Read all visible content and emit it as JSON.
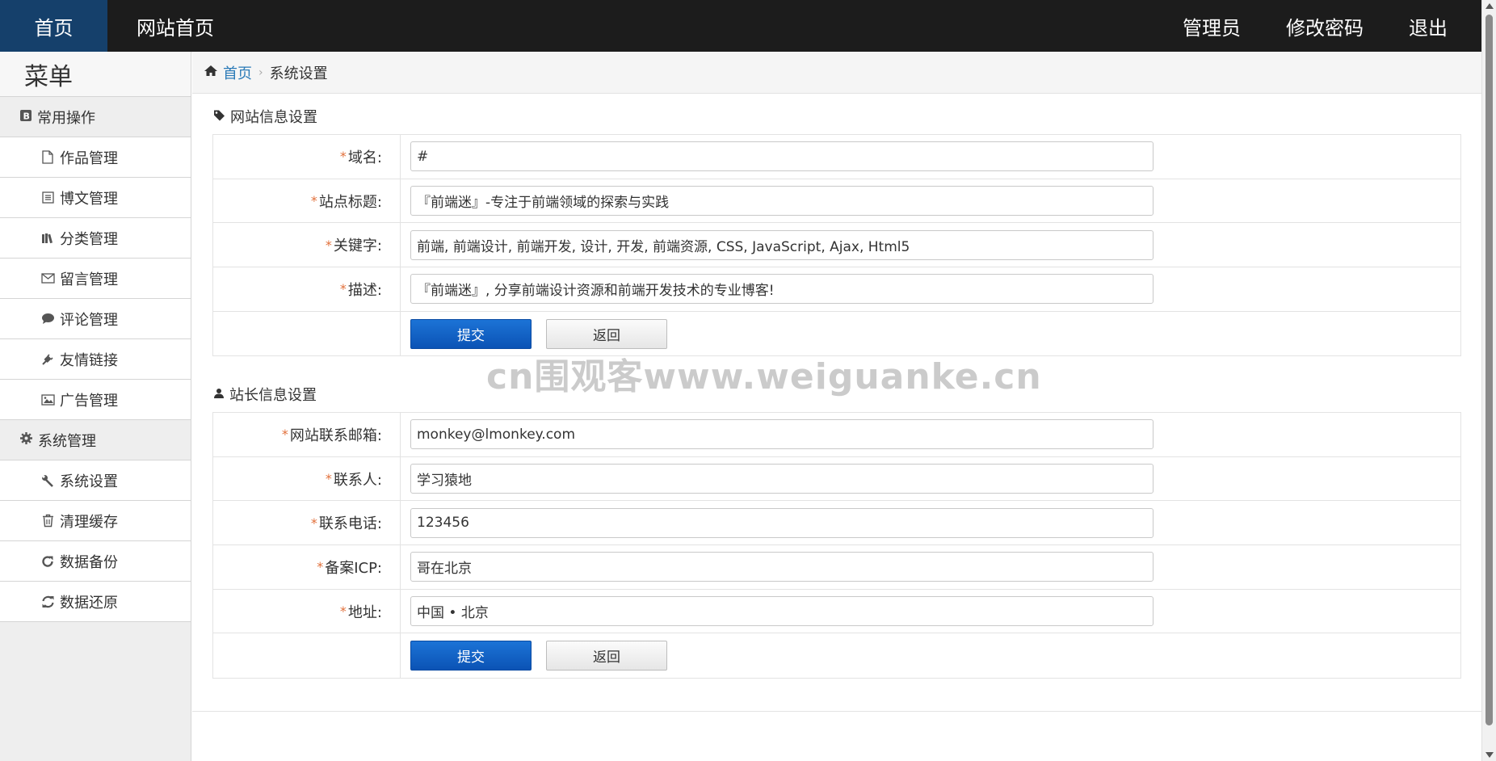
{
  "topbar": {
    "home": "首页",
    "site_home": "网站首页",
    "admin": "管理员",
    "change_password": "修改密码",
    "logout": "退出"
  },
  "sidebar": {
    "title": "菜单",
    "groups": [
      {
        "label": "常用操作",
        "icon": "b-square-icon",
        "items": [
          {
            "label": "作品管理",
            "icon": "file-icon"
          },
          {
            "label": "博文管理",
            "icon": "list-alt-icon"
          },
          {
            "label": "分类管理",
            "icon": "books-icon"
          },
          {
            "label": "留言管理",
            "icon": "envelope-icon"
          },
          {
            "label": "评论管理",
            "icon": "comment-icon"
          },
          {
            "label": "友情链接",
            "icon": "plug-icon"
          },
          {
            "label": "广告管理",
            "icon": "picture-icon"
          }
        ]
      },
      {
        "label": "系统管理",
        "icon": "gear-icon",
        "items": [
          {
            "label": "系统设置",
            "icon": "wrench-icon"
          },
          {
            "label": "清理缓存",
            "icon": "trash-icon"
          },
          {
            "label": "数据备份",
            "icon": "refresh-icon"
          },
          {
            "label": "数据还原",
            "icon": "sync-icon"
          }
        ]
      }
    ]
  },
  "breadcrumb": {
    "home": "首页",
    "current": "系统设置"
  },
  "site_section": {
    "title": "网站信息设置",
    "fields": [
      {
        "label": "域名:",
        "value": "#"
      },
      {
        "label": "站点标题:",
        "value": "『前端迷』-专注于前端领域的探索与实践"
      },
      {
        "label": "关键字:",
        "value": "前端, 前端设计, 前端开发, 设计, 开发, 前端资源, CSS, JavaScript, Ajax, Html5"
      },
      {
        "label": "描述:",
        "value": "『前端迷』, 分享前端设计资源和前端开发技术的专业博客!"
      }
    ],
    "submit": "提交",
    "back": "返回"
  },
  "owner_section": {
    "title": "站长信息设置",
    "fields": [
      {
        "label": "网站联系邮箱:",
        "value": "monkey@lmonkey.com"
      },
      {
        "label": "联系人:",
        "value": "学习猿地"
      },
      {
        "label": "联系电话:",
        "value": "123456"
      },
      {
        "label": "备案ICP:",
        "value": "哥在北京"
      },
      {
        "label": "地址:",
        "value": "中国 • 北京"
      }
    ],
    "submit": "提交",
    "back": "返回"
  },
  "required_mark": "*",
  "watermark": "cn围观客www.weiguanke.cn",
  "colors": {
    "topbar_bg": "#1c1c1c",
    "topbar_active": "#15406b",
    "submit_button": "#0b53b5",
    "required": "#e2703a",
    "link": "#2a7ab7"
  }
}
